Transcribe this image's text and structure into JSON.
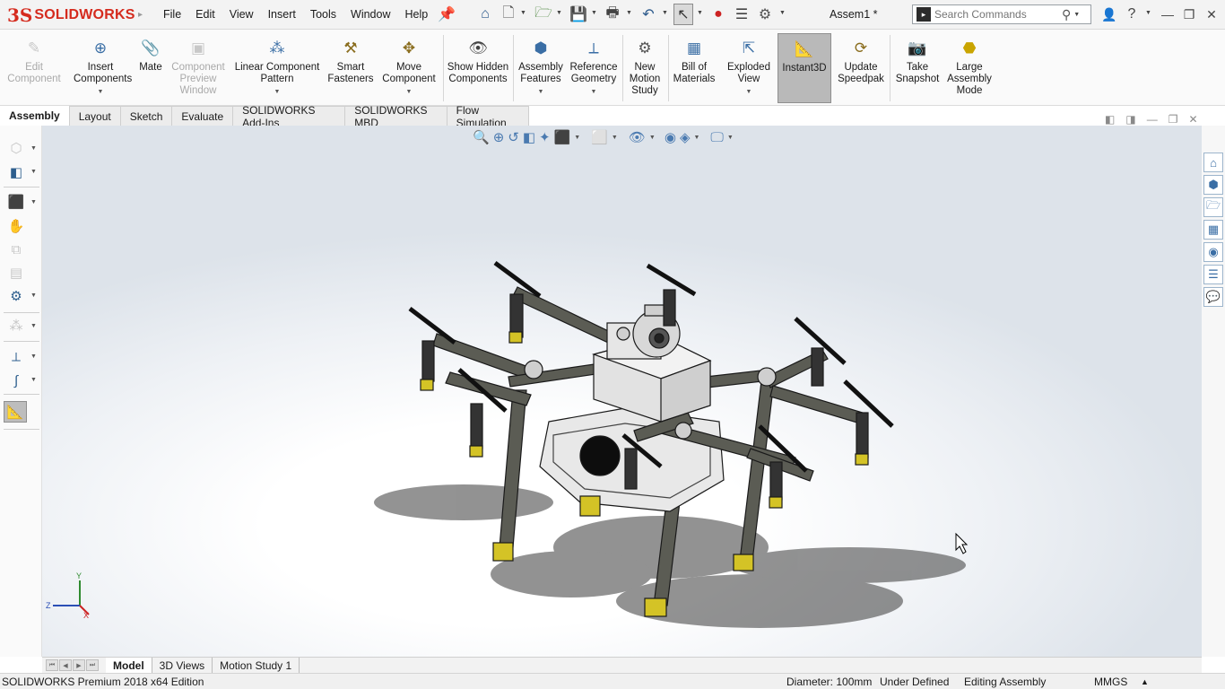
{
  "app": {
    "logo_mark": "3S",
    "logo_text": "SOLIDWORKS",
    "document_title": "Assem1 *"
  },
  "menu": {
    "items": [
      "File",
      "Edit",
      "View",
      "Insert",
      "Tools",
      "Window",
      "Help"
    ]
  },
  "search": {
    "placeholder": "Search Commands"
  },
  "ribbon": {
    "edit_component": "Edit Component",
    "insert_components": "Insert Components",
    "mate": "Mate",
    "component_preview": "Component Preview Window",
    "linear_pattern": "Linear Component Pattern",
    "smart_fasteners": "Smart Fasteners",
    "move_component": "Move Component",
    "show_hidden": "Show Hidden Components",
    "assembly_features": "Assembly Features",
    "reference_geometry": "Reference Geometry",
    "new_motion_study": "New Motion Study",
    "bill_of_materials": "Bill of Materials",
    "exploded_view": "Exploded View",
    "instant3d": "Instant3D",
    "update_speedpak": "Update Speedpak",
    "take_snapshot": "Take Snapshot",
    "large_assembly": "Large Assembly Mode"
  },
  "command_tabs": [
    "Assembly",
    "Layout",
    "Sketch",
    "Evaluate",
    "SOLIDWORKS Add-Ins",
    "SOLIDWORKS MBD",
    "Flow Simulation"
  ],
  "triad": {
    "x": "X",
    "y": "Y",
    "z": "Z"
  },
  "bottom_tabs": [
    "Model",
    "3D Views",
    "Motion Study 1"
  ],
  "status": {
    "edition": "SOLIDWORKS Premium 2018 x64 Edition",
    "diameter": "Diameter: 100mm",
    "defined": "Under Defined",
    "mode": "Editing Assembly",
    "units": "MMGS"
  },
  "colors": {
    "brand": "#d52b1e",
    "frame": "#55574f",
    "leg_tip": "#d4c326",
    "body": "#e6e6e6"
  }
}
